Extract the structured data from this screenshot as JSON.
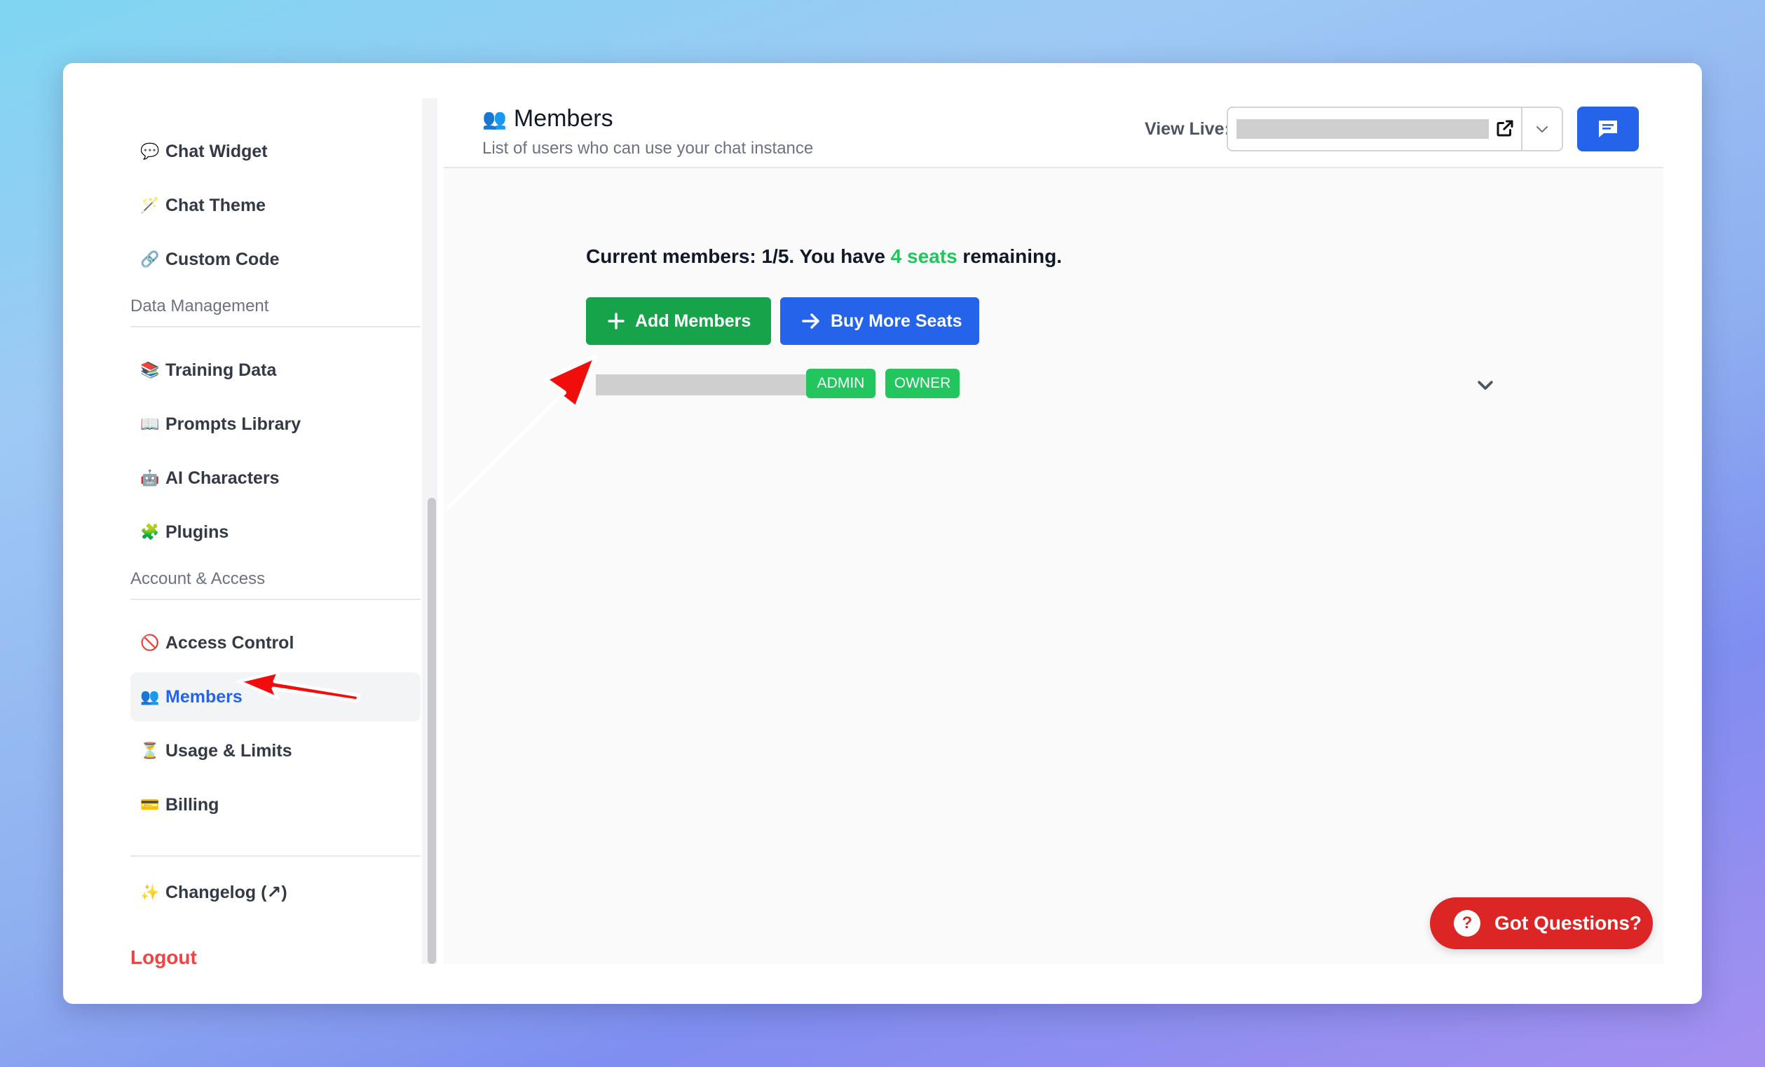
{
  "sidebar": {
    "items_top": [
      {
        "icon": "💬",
        "icon_name": "speech-bubble-icon",
        "label": "Chat Widget"
      },
      {
        "icon": "🪄",
        "icon_name": "magic-wand-icon",
        "label": "Chat Theme"
      },
      {
        "icon": "🔗",
        "icon_name": "link-icon",
        "label": "Custom Code"
      }
    ],
    "section_data": "Data Management",
    "items_data": [
      {
        "icon": "📚",
        "icon_name": "books-icon",
        "label": "Training Data"
      },
      {
        "icon": "📖",
        "icon_name": "open-book-icon",
        "label": "Prompts Library"
      },
      {
        "icon": "🤖",
        "icon_name": "robot-icon",
        "label": "AI Characters"
      },
      {
        "icon": "🧩",
        "icon_name": "puzzle-icon",
        "label": "Plugins"
      }
    ],
    "section_account": "Account & Access",
    "items_account": [
      {
        "icon": "🚫",
        "icon_name": "prohibited-icon",
        "label": "Access Control"
      },
      {
        "icon": "👥",
        "icon_name": "people-icon",
        "label": "Members"
      },
      {
        "icon": "⏳",
        "icon_name": "hourglass-icon",
        "label": "Usage & Limits"
      },
      {
        "icon": "💳",
        "icon_name": "credit-card-icon",
        "label": "Billing"
      }
    ],
    "changelog": {
      "icon": "✨",
      "icon_name": "sparkles-icon",
      "label": "Changelog (↗)"
    },
    "logout": "Logout"
  },
  "header": {
    "icon": "👥",
    "title": "Members",
    "subtitle": "List of users who can use your chat instance",
    "view_live_label": "View Live:"
  },
  "main": {
    "summary_prefix": "Current members: 1/5. You have ",
    "summary_seats": "4 seats",
    "summary_suffix": " remaining.",
    "add_members": "Add Members",
    "buy_more_seats": "Buy More Seats",
    "member": {
      "badges": [
        "ADMIN",
        "OWNER"
      ]
    }
  },
  "help": {
    "label": "Got Questions?",
    "icon": "?"
  },
  "colors": {
    "accent_blue": "#2563eb",
    "success_green": "#16a34a",
    "badge_green": "#22c55e",
    "danger_red": "#dc2626",
    "annotation_arrow": "#f20d0d"
  }
}
